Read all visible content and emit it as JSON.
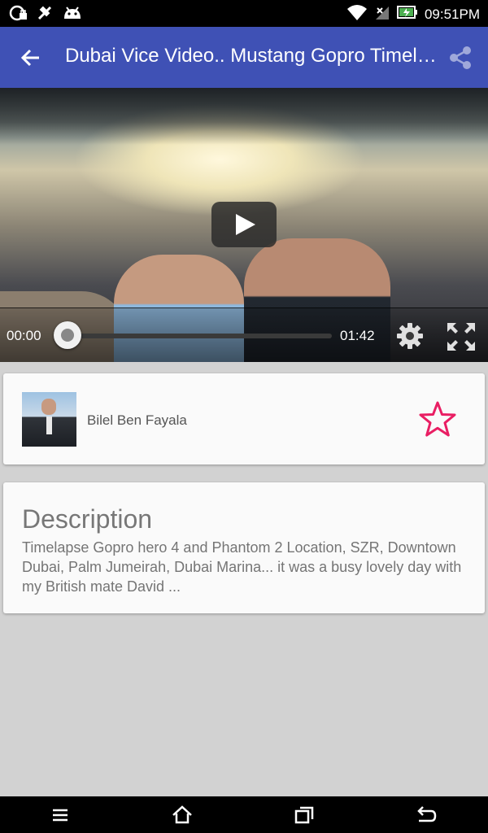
{
  "status_bar": {
    "time": "09:51PM",
    "icons": [
      "rotation-lock-icon",
      "signal-off-icon",
      "android-icon",
      "wifi-icon",
      "no-signal-icon",
      "battery-charging-icon"
    ]
  },
  "app_bar": {
    "title": "Dubai Vice Video.. Mustang Gopro Timelapse",
    "back_icon": "arrow-back-icon",
    "share_icon": "share-icon",
    "color": "#3f51b5"
  },
  "video": {
    "current_time": "00:00",
    "total_time": "01:42",
    "progress": 0.0,
    "play_icon": "play-icon",
    "settings_icon": "gear-icon",
    "fullscreen_icon": "fullscreen-icon"
  },
  "author": {
    "name": "Bilel Ben Fayala",
    "favorite_icon": "star-outline-icon",
    "favorite_color": "#e91e63"
  },
  "description": {
    "heading": "Description",
    "text": "Timelapse Gopro hero 4 and Phantom 2 Location, SZR, Downtown Dubai, Palm Jumeirah, Dubai Marina... it was a busy lovely day with my British mate David ..."
  },
  "nav_bar": {
    "icons": [
      "menu-icon",
      "home-icon",
      "recent-apps-icon",
      "back-icon"
    ]
  }
}
